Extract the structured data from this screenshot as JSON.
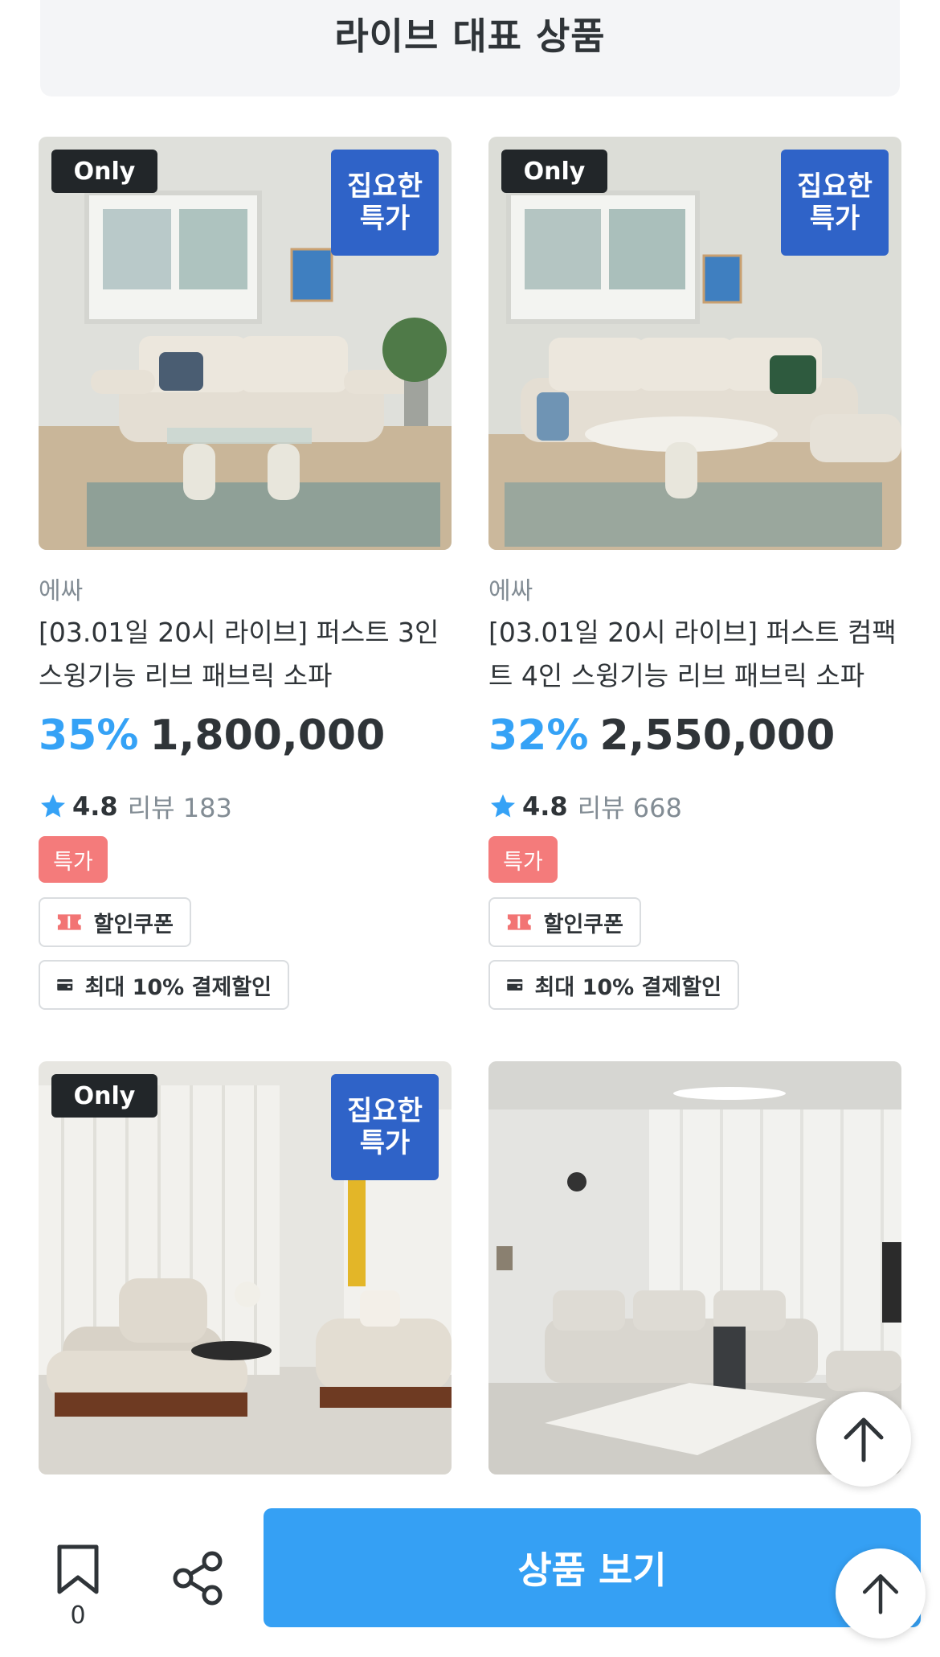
{
  "section_title": "라이브 대표 상품",
  "products": [
    {
      "only_label": "Only",
      "deal_line1": "집요한",
      "deal_line2": "특가",
      "brand": "에싸",
      "title": "[03.01일 20시 라이브] 퍼스트 3인 스윙기능 리브 패브릭 소파",
      "discount": "35%",
      "price": "1,800,000",
      "rating": "4.8",
      "review_label": "리뷰 183",
      "special_tag": "특가",
      "coupon_label": "할인쿠폰",
      "payment_label": "최대 10% 결제할인"
    },
    {
      "only_label": "Only",
      "deal_line1": "집요한",
      "deal_line2": "특가",
      "brand": "에싸",
      "title": "[03.01일 20시 라이브] 퍼스트 컴팩트 4인 스윙기능 리브 패브릭 소파",
      "discount": "32%",
      "price": "2,550,000",
      "rating": "4.8",
      "review_label": "리뷰 668",
      "special_tag": "특가",
      "coupon_label": "할인쿠폰",
      "payment_label": "최대 10% 결제할인"
    },
    {
      "only_label": "Only",
      "deal_line1": "집요한",
      "deal_line2": "특가"
    },
    {}
  ],
  "bottom_bar": {
    "bookmark_count": "0",
    "cta_label": "상품 보기"
  },
  "colors": {
    "accent_blue": "#35a0f4",
    "discount_blue": "#35a2f6",
    "deal_badge_blue": "#2f63c8",
    "special_tag_red": "#f47b7b"
  },
  "icons": [
    "star-icon",
    "coupon-icon",
    "card-icon",
    "bookmark-icon",
    "share-icon",
    "arrow-up-icon"
  ]
}
